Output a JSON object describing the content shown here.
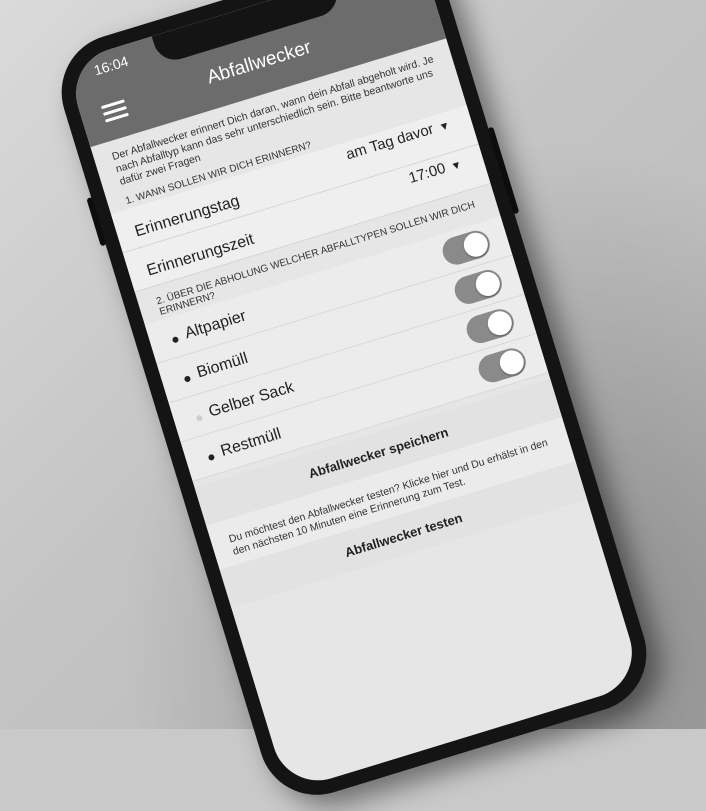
{
  "status": {
    "time": "16:04"
  },
  "app": {
    "title": "Abfallwecker"
  },
  "intro": "Der Abfallwecker erinnert Dich daran, wann dein Abfall abgeholt wird. Je nach Abfalltyp kann das sehr unterschiedlich sein. Bitte beantworte uns dafür zwei Fragen",
  "question1": "1. WANN SOLLEN WIR DICH ERINNERN?",
  "reminder_day": {
    "label": "Erinnerungstag",
    "value": "am Tag davor"
  },
  "reminder_time": {
    "label": "Erinnerungszeit",
    "value": "17:00"
  },
  "question2": "2. ÜBER DIE ABHOLUNG WELCHER ABFALLTYPEN SOLLEN WIR DICH ERINNERN?",
  "waste_types": [
    {
      "label": "Altpapier",
      "enabled": true
    },
    {
      "label": "Biomüll",
      "enabled": true
    },
    {
      "label": "Gelber Sack",
      "enabled": true
    },
    {
      "label": "Restmüll",
      "enabled": true
    }
  ],
  "save_button": "Abfallwecker speichern",
  "test_text": "Du möchtest den Abfallwecker testen? Klicke hier und Du erhälst in den den nächsten 10 Minuten eine Erinnerung zum Test.",
  "test_button": "Abfallwecker testen"
}
